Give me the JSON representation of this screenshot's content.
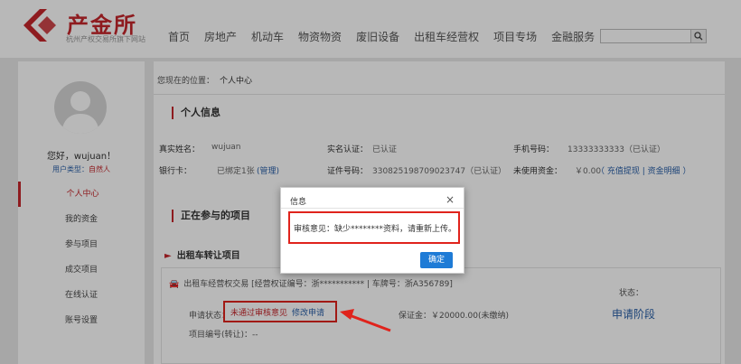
{
  "header": {
    "logo_title": "产金所",
    "logo_subtitle": "杭州产权交易所旗下网站",
    "nav": [
      "首页",
      "房地产",
      "机动车",
      "物资物资",
      "废旧设备",
      "出租车经营权",
      "项目专场",
      "金融服务"
    ],
    "search_placeholder": ""
  },
  "sidebar": {
    "greeting": "您好，wujuan！",
    "user_type_label": "用户类型：",
    "user_type_value": "自然人",
    "items": [
      {
        "label": "个人中心",
        "active": true
      },
      {
        "label": "我的资金"
      },
      {
        "label": "参与项目"
      },
      {
        "label": "成交项目"
      },
      {
        "label": "在线认证"
      },
      {
        "label": "账号设置"
      }
    ]
  },
  "main": {
    "crumb_prefix": "您现在的位置：",
    "crumb_current": "个人中心",
    "personal_title": "个人信息",
    "info": {
      "name_k": "真实姓名：",
      "name_v": "wujuan",
      "realname_k": "实名认证：",
      "realname_v": "已认证",
      "phone_k": "手机号码：",
      "phone_v": "13333333333（已认证）",
      "bank_k": "银行卡：",
      "bank_v": "已绑定1张",
      "bank_link": "(管理)",
      "idno_k": "证件号码：",
      "idno_v": "330825198709023747（已认证）",
      "funds_k": "未使用资金：",
      "funds_v": "￥0.00",
      "funds_link": "（ 充值提现 | 资金明细 ）"
    },
    "projects_title": "正在参与的项目",
    "sub_title": "出租车转让项目",
    "card": {
      "line1_icon": "car-icon",
      "line1": "出租车经营权交易    [经营权证编号：浙*********** | 车牌号：浙A356789]",
      "status_label": "状态：",
      "status_value": "申请阶段",
      "apply_label": "申请状态：",
      "apply_status": "未通过审核意见",
      "apply_link": "修改申请",
      "deposit": "保证金：￥20000.00(未缴纳)",
      "proj_no": "项目编号(转让)：--"
    }
  },
  "dialog": {
    "title": "信息",
    "close": "×",
    "message": "审核意见：缺少********资料，请重新上传。",
    "ok": "确定"
  },
  "colors": {
    "brand_red": "#c5262b",
    "link_blue": "#2a60a8",
    "button_blue": "#1e7bd6",
    "highlight_red": "#e0231c"
  }
}
